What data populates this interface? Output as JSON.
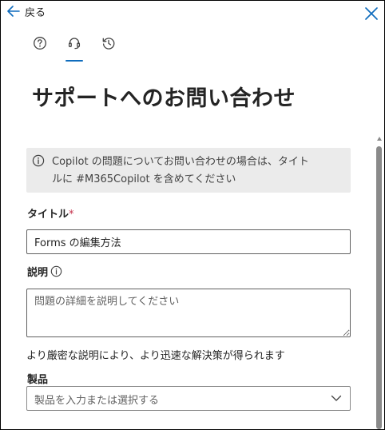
{
  "header": {
    "back_label": "戻る",
    "back_icon": "arrow-left-icon",
    "close_icon": "close-icon"
  },
  "tabs": [
    {
      "name": "help",
      "icon": "question-circle-icon",
      "active": false
    },
    {
      "name": "support",
      "icon": "headset-icon",
      "active": true
    },
    {
      "name": "history",
      "icon": "history-icon",
      "active": false
    }
  ],
  "page": {
    "title": "サポートへのお問い合わせ"
  },
  "info": {
    "line1": "Copilot の問題についてお問い合わせの場合は、タイト",
    "line2": "ルに #M365Copilot を含めてください"
  },
  "form": {
    "title_label": "タイトル",
    "required_mark": "*",
    "title_value": "Forms の編集方法",
    "description_label": "説明",
    "description_placeholder": "問題の詳細を説明してください",
    "helper_text": "より厳密な説明により、より迅速な解決策が得られます",
    "product_label": "製品",
    "product_placeholder": "製品を入力または選択する"
  },
  "colors": {
    "accent": "#0f6cbd",
    "info_bg": "#ebebeb",
    "required": "#c4314b"
  }
}
